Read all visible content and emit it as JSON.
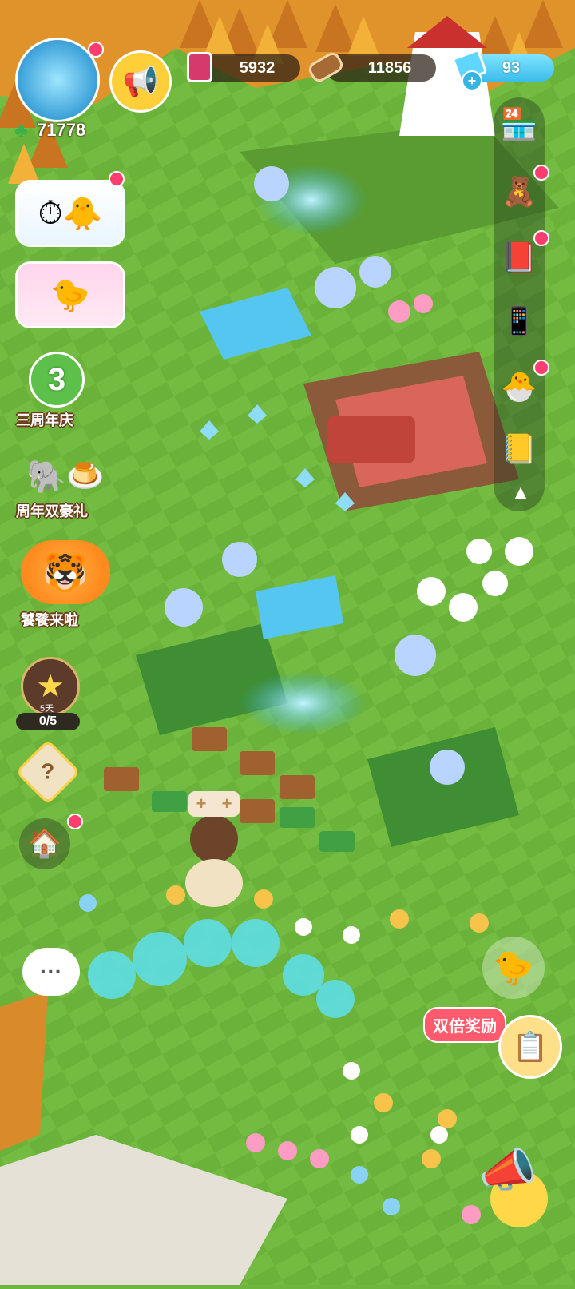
{
  "resources": {
    "clover_count": "71778",
    "jam": "5932",
    "wood": "11856",
    "gems": "93",
    "gem_plus": "+"
  },
  "left_events": {
    "anniversary": "三周年庆",
    "anniversary_badge": "3",
    "double_gift": "周年双豪礼",
    "meal": "饕餮来啦",
    "star_timer": "5天",
    "star_progress": "0/5",
    "mystery_mark": "?"
  },
  "right_events": {
    "double_reward": "双倍奖励"
  },
  "crate_plus": [
    "+",
    "+"
  ],
  "chat_dots": "···",
  "colors": {
    "grass": "#6fb63e",
    "forest": "#d88a26",
    "pill_bg": "#2b2118",
    "notify_dot": "#ff3d6e",
    "gem_bar": "#5fd6ff"
  }
}
